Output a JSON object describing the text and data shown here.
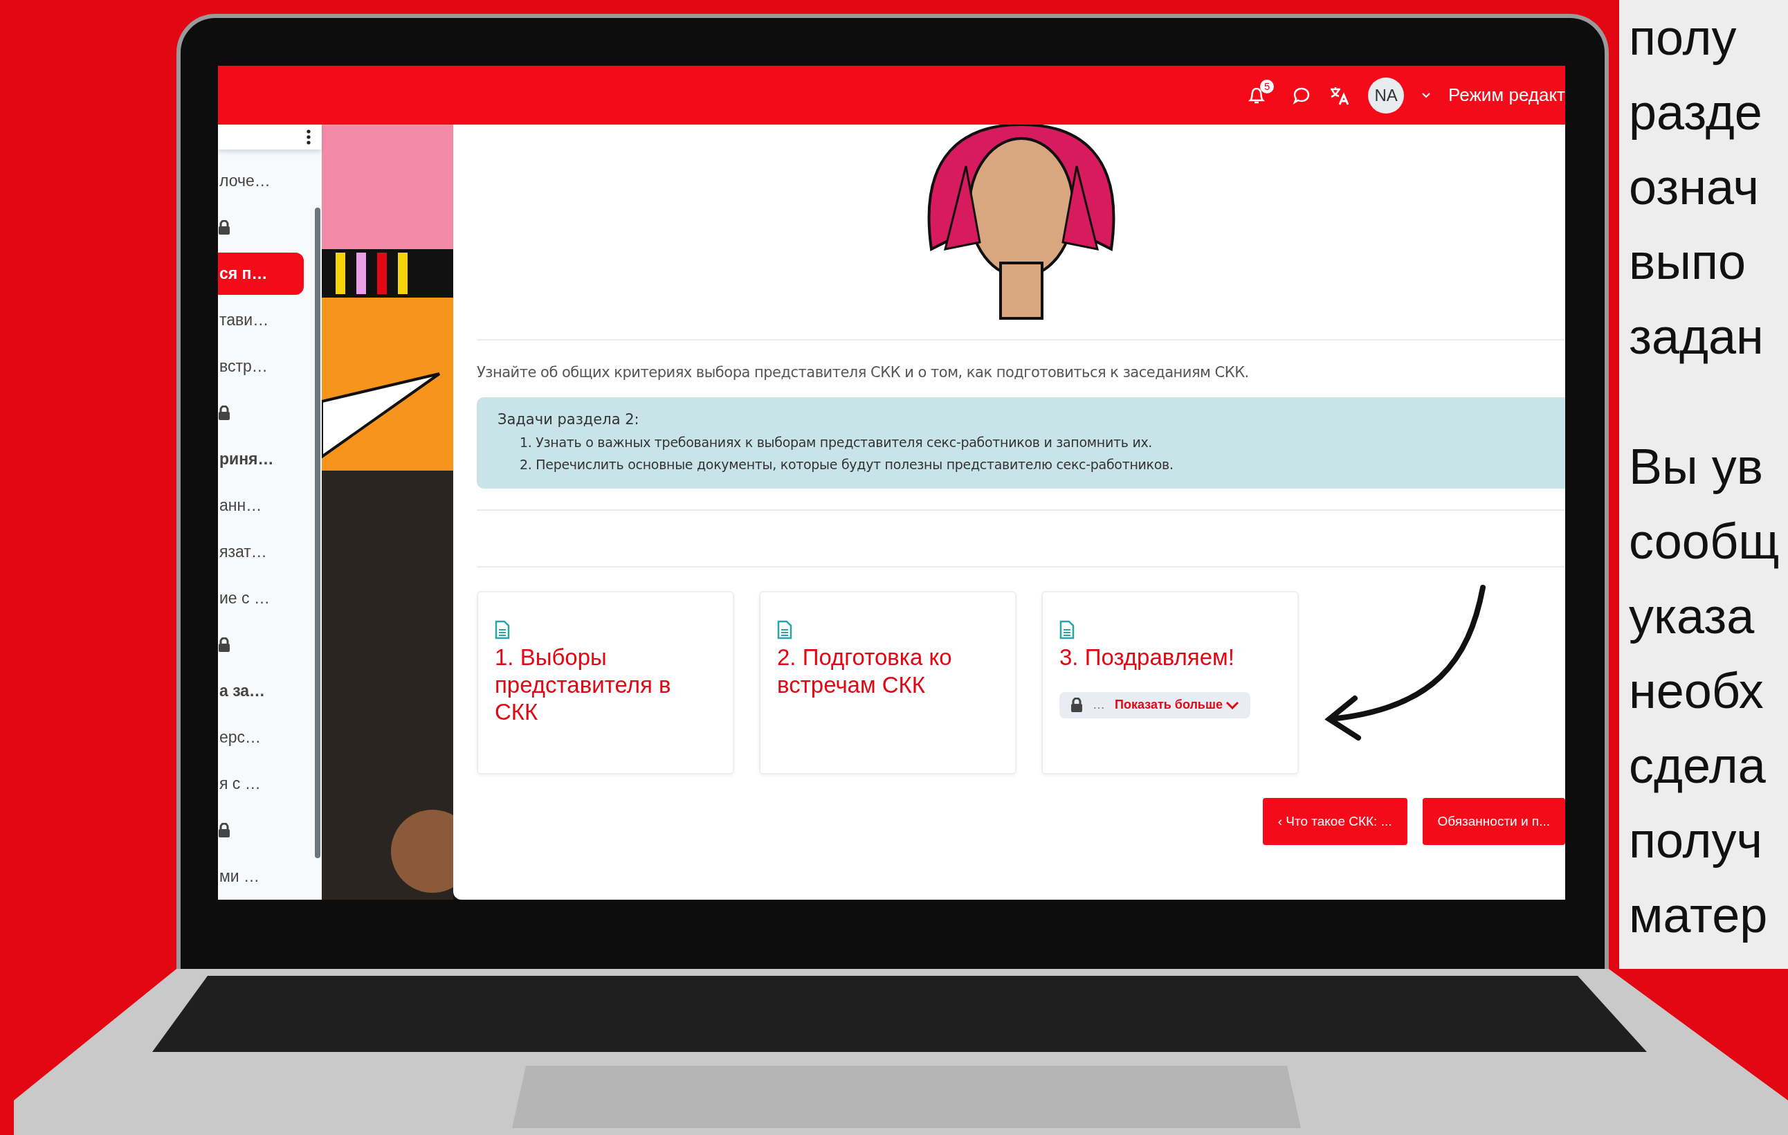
{
  "topbar": {
    "notification_count": "5",
    "avatar": "NA",
    "mode_label": "Режим редакт"
  },
  "sidebar": {
    "items": [
      {
        "kind": "text",
        "label": "лоче…",
        "bold": false,
        "selected": false
      },
      {
        "kind": "lock"
      },
      {
        "kind": "text",
        "label": "ся п…",
        "bold": true,
        "selected": true
      },
      {
        "kind": "text",
        "label": "тави…",
        "bold": false,
        "selected": false
      },
      {
        "kind": "text",
        "label": "встр…",
        "bold": false,
        "selected": false
      },
      {
        "kind": "lock"
      },
      {
        "kind": "text",
        "label": "риня…",
        "bold": true,
        "selected": false
      },
      {
        "kind": "text",
        "label": "анн…",
        "bold": false,
        "selected": false
      },
      {
        "kind": "text",
        "label": "язат…",
        "bold": false,
        "selected": false
      },
      {
        "kind": "text",
        "label": "ие с …",
        "bold": false,
        "selected": false
      },
      {
        "kind": "lock"
      },
      {
        "kind": "text",
        "label": "а за…",
        "bold": true,
        "selected": false
      },
      {
        "kind": "text",
        "label": "ерс…",
        "bold": false,
        "selected": false
      },
      {
        "kind": "text",
        "label": "я с …",
        "bold": false,
        "selected": false
      },
      {
        "kind": "lock"
      },
      {
        "kind": "text",
        "label": "ми …",
        "bold": false,
        "selected": false
      }
    ]
  },
  "section": {
    "description": "Узнайте об общих критериях выбора представителя СКК и о том, как подготовиться к заседаниям СКК.",
    "tasks": {
      "title": "Задачи раздела 2:",
      "items": [
        "1. Узнать о важных требованиях к выборам представителя секс-работников и запомнить их.",
        "2. Перечислить основные документы, которые будут полезны представителю секс-работников."
      ]
    },
    "cards": [
      {
        "title": "1. Выборы представителя в СКК",
        "locked": false
      },
      {
        "title": "2. Подготовка ко встречам СКК",
        "locked": false
      },
      {
        "title": "3. Поздравляем!",
        "locked": true,
        "ellipsis": "…",
        "more": "Показать больше"
      }
    ],
    "nav_buttons": [
      "‹ Что такое СКК: ...",
      "Обязанности и п..."
    ]
  },
  "side_text": {
    "paragraphs": [
      [
        "полу",
        "разде",
        "означ",
        "выпо",
        "задан"
      ],
      [
        "Вы ув",
        "сообщ",
        "указа",
        "необх",
        "сдела",
        "получ",
        "матер"
      ]
    ]
  }
}
